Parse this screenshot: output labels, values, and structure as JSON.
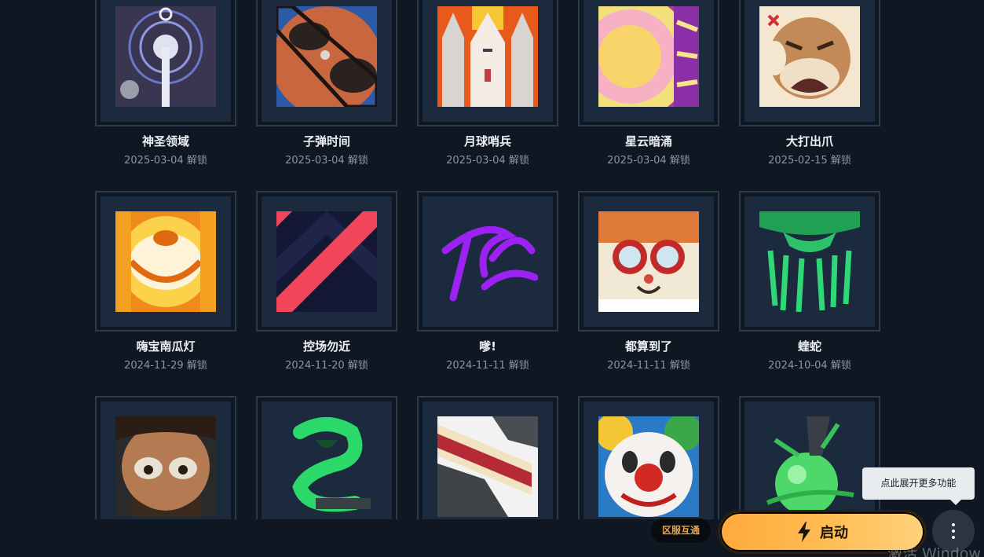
{
  "unlock_suffix": "解锁",
  "cards": [
    {
      "name": "神圣领域",
      "date": "2025-03-04",
      "icon": "sacred-domain-icon"
    },
    {
      "name": "子弹时间",
      "date": "2025-03-04",
      "icon": "bullet-time-icon"
    },
    {
      "name": "月球哨兵",
      "date": "2025-03-04",
      "icon": "lunar-sentinel-icon"
    },
    {
      "name": "星云暗涌",
      "date": "2025-03-04",
      "icon": "nebula-surge-icon"
    },
    {
      "name": "大打出爪",
      "date": "2025-02-15",
      "icon": "angry-cat-icon"
    },
    {
      "name": "嗨宝南瓜灯",
      "date": "2024-11-29",
      "icon": "pumpkin-lantern-icon"
    },
    {
      "name": "控场勿近",
      "date": "2024-11-20",
      "icon": "stripe-chevron-icon"
    },
    {
      "name": "嗲!",
      "date": "2024-11-11",
      "icon": "purple-scribble-icon"
    },
    {
      "name": "都算到了",
      "date": "2024-11-11",
      "icon": "goggles-cat-icon"
    },
    {
      "name": "蝰蛇",
      "date": "2024-10-04",
      "icon": "viper-logo-icon"
    },
    {
      "name": "",
      "date": "",
      "icon": "bearded-man-icon"
    },
    {
      "name": "",
      "date": "",
      "icon": "green-snake-icon"
    },
    {
      "name": "",
      "date": "",
      "icon": "cake-slice-icon"
    },
    {
      "name": "",
      "date": "",
      "icon": "clown-icon"
    },
    {
      "name": "",
      "date": "",
      "icon": "green-orb-icon"
    }
  ],
  "region_badge": "区服互通",
  "launch_label": "启动",
  "more_tooltip": "点此展开更多功能",
  "watermark": "激活 Window",
  "colors": {
    "background": "#0f1822",
    "frame_border": "#2c3a4b",
    "frame_inner": "#1b2a3d",
    "launch_gradient_start": "#ffaa3a",
    "launch_gradient_end": "#ffd27a",
    "badge_text": "#e7a24c"
  }
}
